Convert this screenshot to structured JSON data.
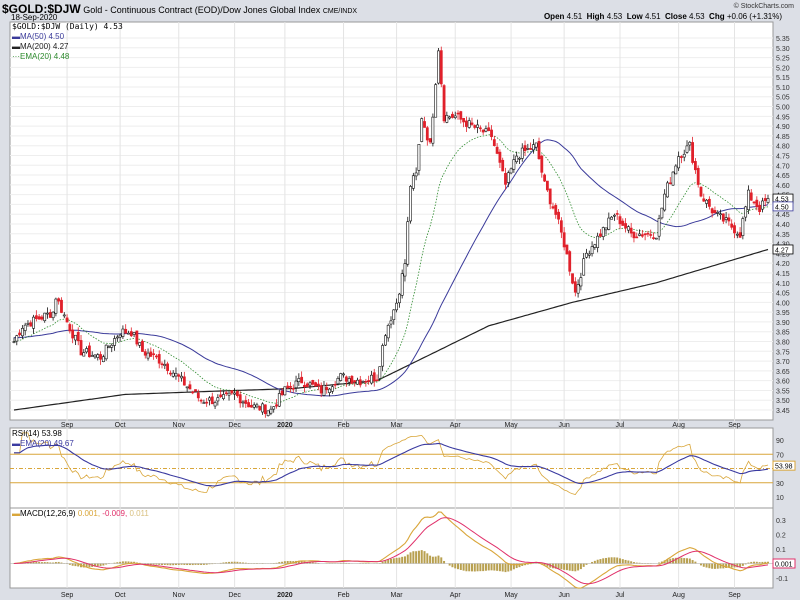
{
  "header": {
    "symbol": "$GOLD:$DJW",
    "description": "Gold - Continuous Contract (EOD)/Dow Jones Global Index",
    "exchange": "CME/INDX",
    "date": "18-Sep-2020",
    "copyright": "© StockCharts.com",
    "open_label": "Open",
    "open": "4.51",
    "high_label": "High",
    "high": "4.53",
    "low_label": "Low",
    "low": "4.51",
    "close_label": "Close",
    "close": "4.53",
    "chg_label": "Chg",
    "chg": "+0.06 (+1.31%)"
  },
  "legend": {
    "main": "$GOLD:$DJW (Daily) 4.53",
    "ma50": "MA(50) 4.50",
    "ma200": "MA(200) 4.27",
    "ema20": "EMA(20) 4.48",
    "rsi": "RSI(14) 53.98",
    "rsi_ema": "EMA(20) 49.67",
    "macd_label": "MACD(12,26,9)",
    "macd_v1": "0.001,",
    "macd_v2": "-0.009,",
    "macd_v3": "0.011"
  },
  "colors": {
    "ma50": "#3a3a9a",
    "ma200": "#222222",
    "ema20": "#2e8b2e",
    "down": "#e0202a",
    "up": "#111111",
    "rsi": "#d9a63a",
    "rsi_ema": "#3a3aa0",
    "macd": "#d9a63a",
    "signal": "#e0306a",
    "hist": "#b8a050"
  },
  "chart_data": {
    "type": "candlestick",
    "title": "$GOLD:$DJW (Daily)",
    "ylim": [
      3.42,
      5.37
    ],
    "yticks": [
      "3.45",
      "3.50",
      "3.55",
      "3.60",
      "3.65",
      "3.70",
      "3.75",
      "3.80",
      "3.85",
      "3.90",
      "3.95",
      "4.00",
      "4.05",
      "4.10",
      "4.15",
      "4.20",
      "4.25",
      "4.30",
      "4.35",
      "4.40",
      "4.45",
      "4.50",
      "4.55",
      "4.60",
      "4.65",
      "4.70",
      "4.75",
      "4.80",
      "4.85",
      "4.90",
      "4.95",
      "5.00",
      "5.05",
      "5.10",
      "5.15",
      "5.20",
      "5.25",
      "5.30",
      "5.35"
    ],
    "x_ticks": [
      {
        "label": "Sep",
        "day": 19
      },
      {
        "label": "Oct",
        "day": 38
      },
      {
        "label": "Nov",
        "day": 59
      },
      {
        "label": "Dec",
        "day": 79
      },
      {
        "label": "2020",
        "day": 97
      },
      {
        "label": "Feb",
        "day": 118
      },
      {
        "label": "Mar",
        "day": 137
      },
      {
        "label": "Apr",
        "day": 158
      },
      {
        "label": "May",
        "day": 178
      },
      {
        "label": "Jun",
        "day": 197
      },
      {
        "label": "Jul",
        "day": 217
      },
      {
        "label": "Aug",
        "day": 238
      },
      {
        "label": "Sep",
        "day": 258
      }
    ],
    "close_keypoints": [
      [
        0,
        3.8
      ],
      [
        3,
        3.88
      ],
      [
        14,
        3.95
      ],
      [
        15,
        4.03
      ],
      [
        19,
        3.9
      ],
      [
        24,
        3.75
      ],
      [
        31,
        3.72
      ],
      [
        38,
        3.85
      ],
      [
        42,
        3.85
      ],
      [
        46,
        3.75
      ],
      [
        53,
        3.7
      ],
      [
        60,
        3.6
      ],
      [
        67,
        3.5
      ],
      [
        74,
        3.5
      ],
      [
        79,
        3.53
      ],
      [
        85,
        3.47
      ],
      [
        92,
        3.45
      ],
      [
        97,
        3.55
      ],
      [
        103,
        3.6
      ],
      [
        110,
        3.55
      ],
      [
        117,
        3.62
      ],
      [
        124,
        3.6
      ],
      [
        130,
        3.62
      ],
      [
        133,
        3.85
      ],
      [
        137,
        4.0
      ],
      [
        140,
        4.2
      ],
      [
        142,
        4.6
      ],
      [
        144,
        4.65
      ],
      [
        146,
        4.95
      ],
      [
        149,
        4.8
      ],
      [
        152,
        5.3
      ],
      [
        154,
        4.95
      ],
      [
        158,
        4.95
      ],
      [
        164,
        4.9
      ],
      [
        171,
        4.85
      ],
      [
        176,
        4.6
      ],
      [
        180,
        4.75
      ],
      [
        187,
        4.8
      ],
      [
        190,
        4.6
      ],
      [
        194,
        4.45
      ],
      [
        197,
        4.3
      ],
      [
        201,
        4.05
      ],
      [
        205,
        4.25
      ],
      [
        210,
        4.35
      ],
      [
        215,
        4.45
      ],
      [
        221,
        4.35
      ],
      [
        230,
        4.35
      ],
      [
        233,
        4.55
      ],
      [
        238,
        4.75
      ],
      [
        242,
        4.8
      ],
      [
        246,
        4.55
      ],
      [
        251,
        4.45
      ],
      [
        256,
        4.4
      ],
      [
        260,
        4.35
      ],
      [
        263,
        4.55
      ],
      [
        267,
        4.48
      ],
      [
        270,
        4.53
      ]
    ],
    "ma200_keypoints": [
      [
        0,
        3.45
      ],
      [
        40,
        3.53
      ],
      [
        100,
        3.56
      ],
      [
        130,
        3.6
      ],
      [
        170,
        3.88
      ],
      [
        200,
        4.0
      ],
      [
        230,
        4.1
      ],
      [
        270,
        4.27
      ]
    ],
    "last_values": {
      "close": "4.53",
      "ma50": "4.50",
      "ma200": "4.27"
    },
    "rsi": {
      "ylim": [
        0,
        100
      ],
      "yticks": [
        "90",
        "70",
        "30",
        "10"
      ],
      "overbought": 70,
      "oversold": 30,
      "last": "53.98"
    },
    "macd": {
      "ylim": [
        -0.15,
        0.35
      ],
      "yticks": [
        "0.3",
        "0.2",
        "0.1",
        "-0.1"
      ],
      "last": "0.001"
    }
  }
}
